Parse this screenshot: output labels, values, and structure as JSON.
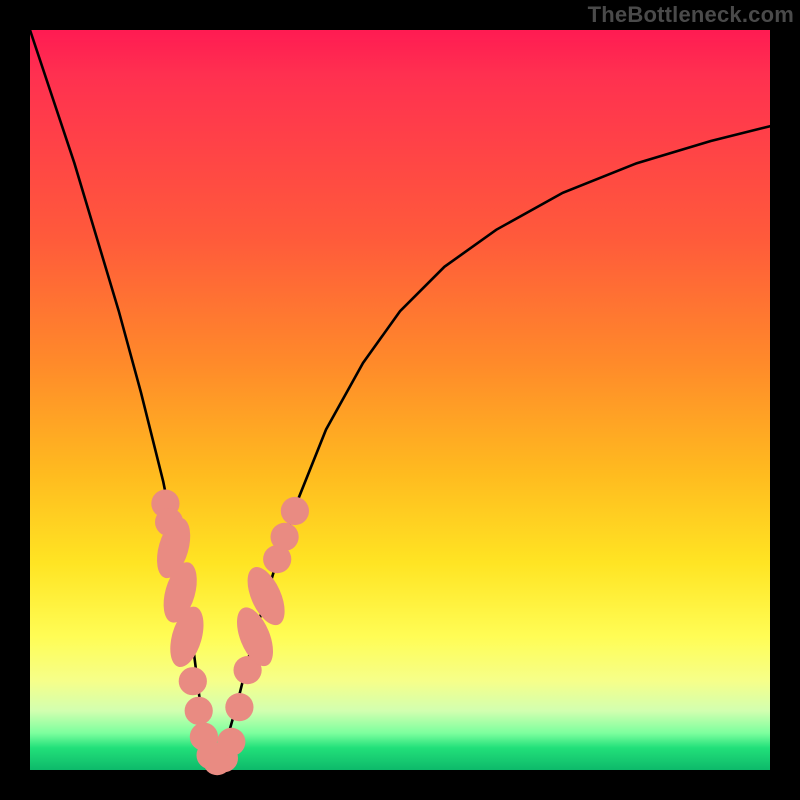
{
  "watermark": "TheBottleneck.com",
  "chart_data": {
    "type": "line",
    "title": "",
    "xlabel": "",
    "ylabel": "",
    "xlim": [
      0,
      100
    ],
    "ylim": [
      0,
      100
    ],
    "series": [
      {
        "name": "bottleneck-curve",
        "x": [
          0,
          3,
          6,
          9,
          12,
          15,
          18,
          20,
          22,
          23,
          24,
          25,
          26,
          28,
          30,
          33,
          36,
          40,
          45,
          50,
          56,
          63,
          72,
          82,
          92,
          100
        ],
        "values": [
          100,
          91,
          82,
          72,
          62,
          51,
          39,
          29,
          17,
          9,
          3,
          0,
          2,
          9,
          17,
          27,
          36,
          46,
          55,
          62,
          68,
          73,
          78,
          82,
          85,
          87
        ]
      }
    ],
    "markers": {
      "name": "highlight-nodes",
      "color": "#e98b82",
      "points": [
        {
          "x": 18.3,
          "y": 36,
          "r": 1.9
        },
        {
          "x": 18.8,
          "y": 33.5,
          "r": 1.9
        },
        {
          "x": 19.4,
          "y": 30.0,
          "rx": 2.0,
          "ry": 4.2,
          "rot": 16
        },
        {
          "x": 20.3,
          "y": 24.0,
          "rx": 2.0,
          "ry": 4.2,
          "rot": 16
        },
        {
          "x": 21.2,
          "y": 18.0,
          "rx": 2.0,
          "ry": 4.2,
          "rot": 16
        },
        {
          "x": 22.0,
          "y": 12.0,
          "r": 1.9
        },
        {
          "x": 22.8,
          "y": 8.0,
          "r": 1.9
        },
        {
          "x": 23.5,
          "y": 4.5,
          "r": 1.9
        },
        {
          "x": 24.4,
          "y": 2.0,
          "r": 1.9
        },
        {
          "x": 25.3,
          "y": 1.2,
          "r": 1.9
        },
        {
          "x": 26.2,
          "y": 1.6,
          "r": 1.9
        },
        {
          "x": 27.2,
          "y": 3.8,
          "r": 1.9
        },
        {
          "x": 28.3,
          "y": 8.5,
          "r": 1.9
        },
        {
          "x": 29.4,
          "y": 13.5,
          "r": 1.9
        },
        {
          "x": 30.4,
          "y": 18.0,
          "rx": 2.0,
          "ry": 4.2,
          "rot": -22
        },
        {
          "x": 31.9,
          "y": 23.5,
          "rx": 2.0,
          "ry": 4.2,
          "rot": -24
        },
        {
          "x": 33.4,
          "y": 28.5,
          "r": 1.9
        },
        {
          "x": 34.4,
          "y": 31.5,
          "r": 1.9
        },
        {
          "x": 35.8,
          "y": 35.0,
          "r": 1.9
        }
      ]
    }
  }
}
